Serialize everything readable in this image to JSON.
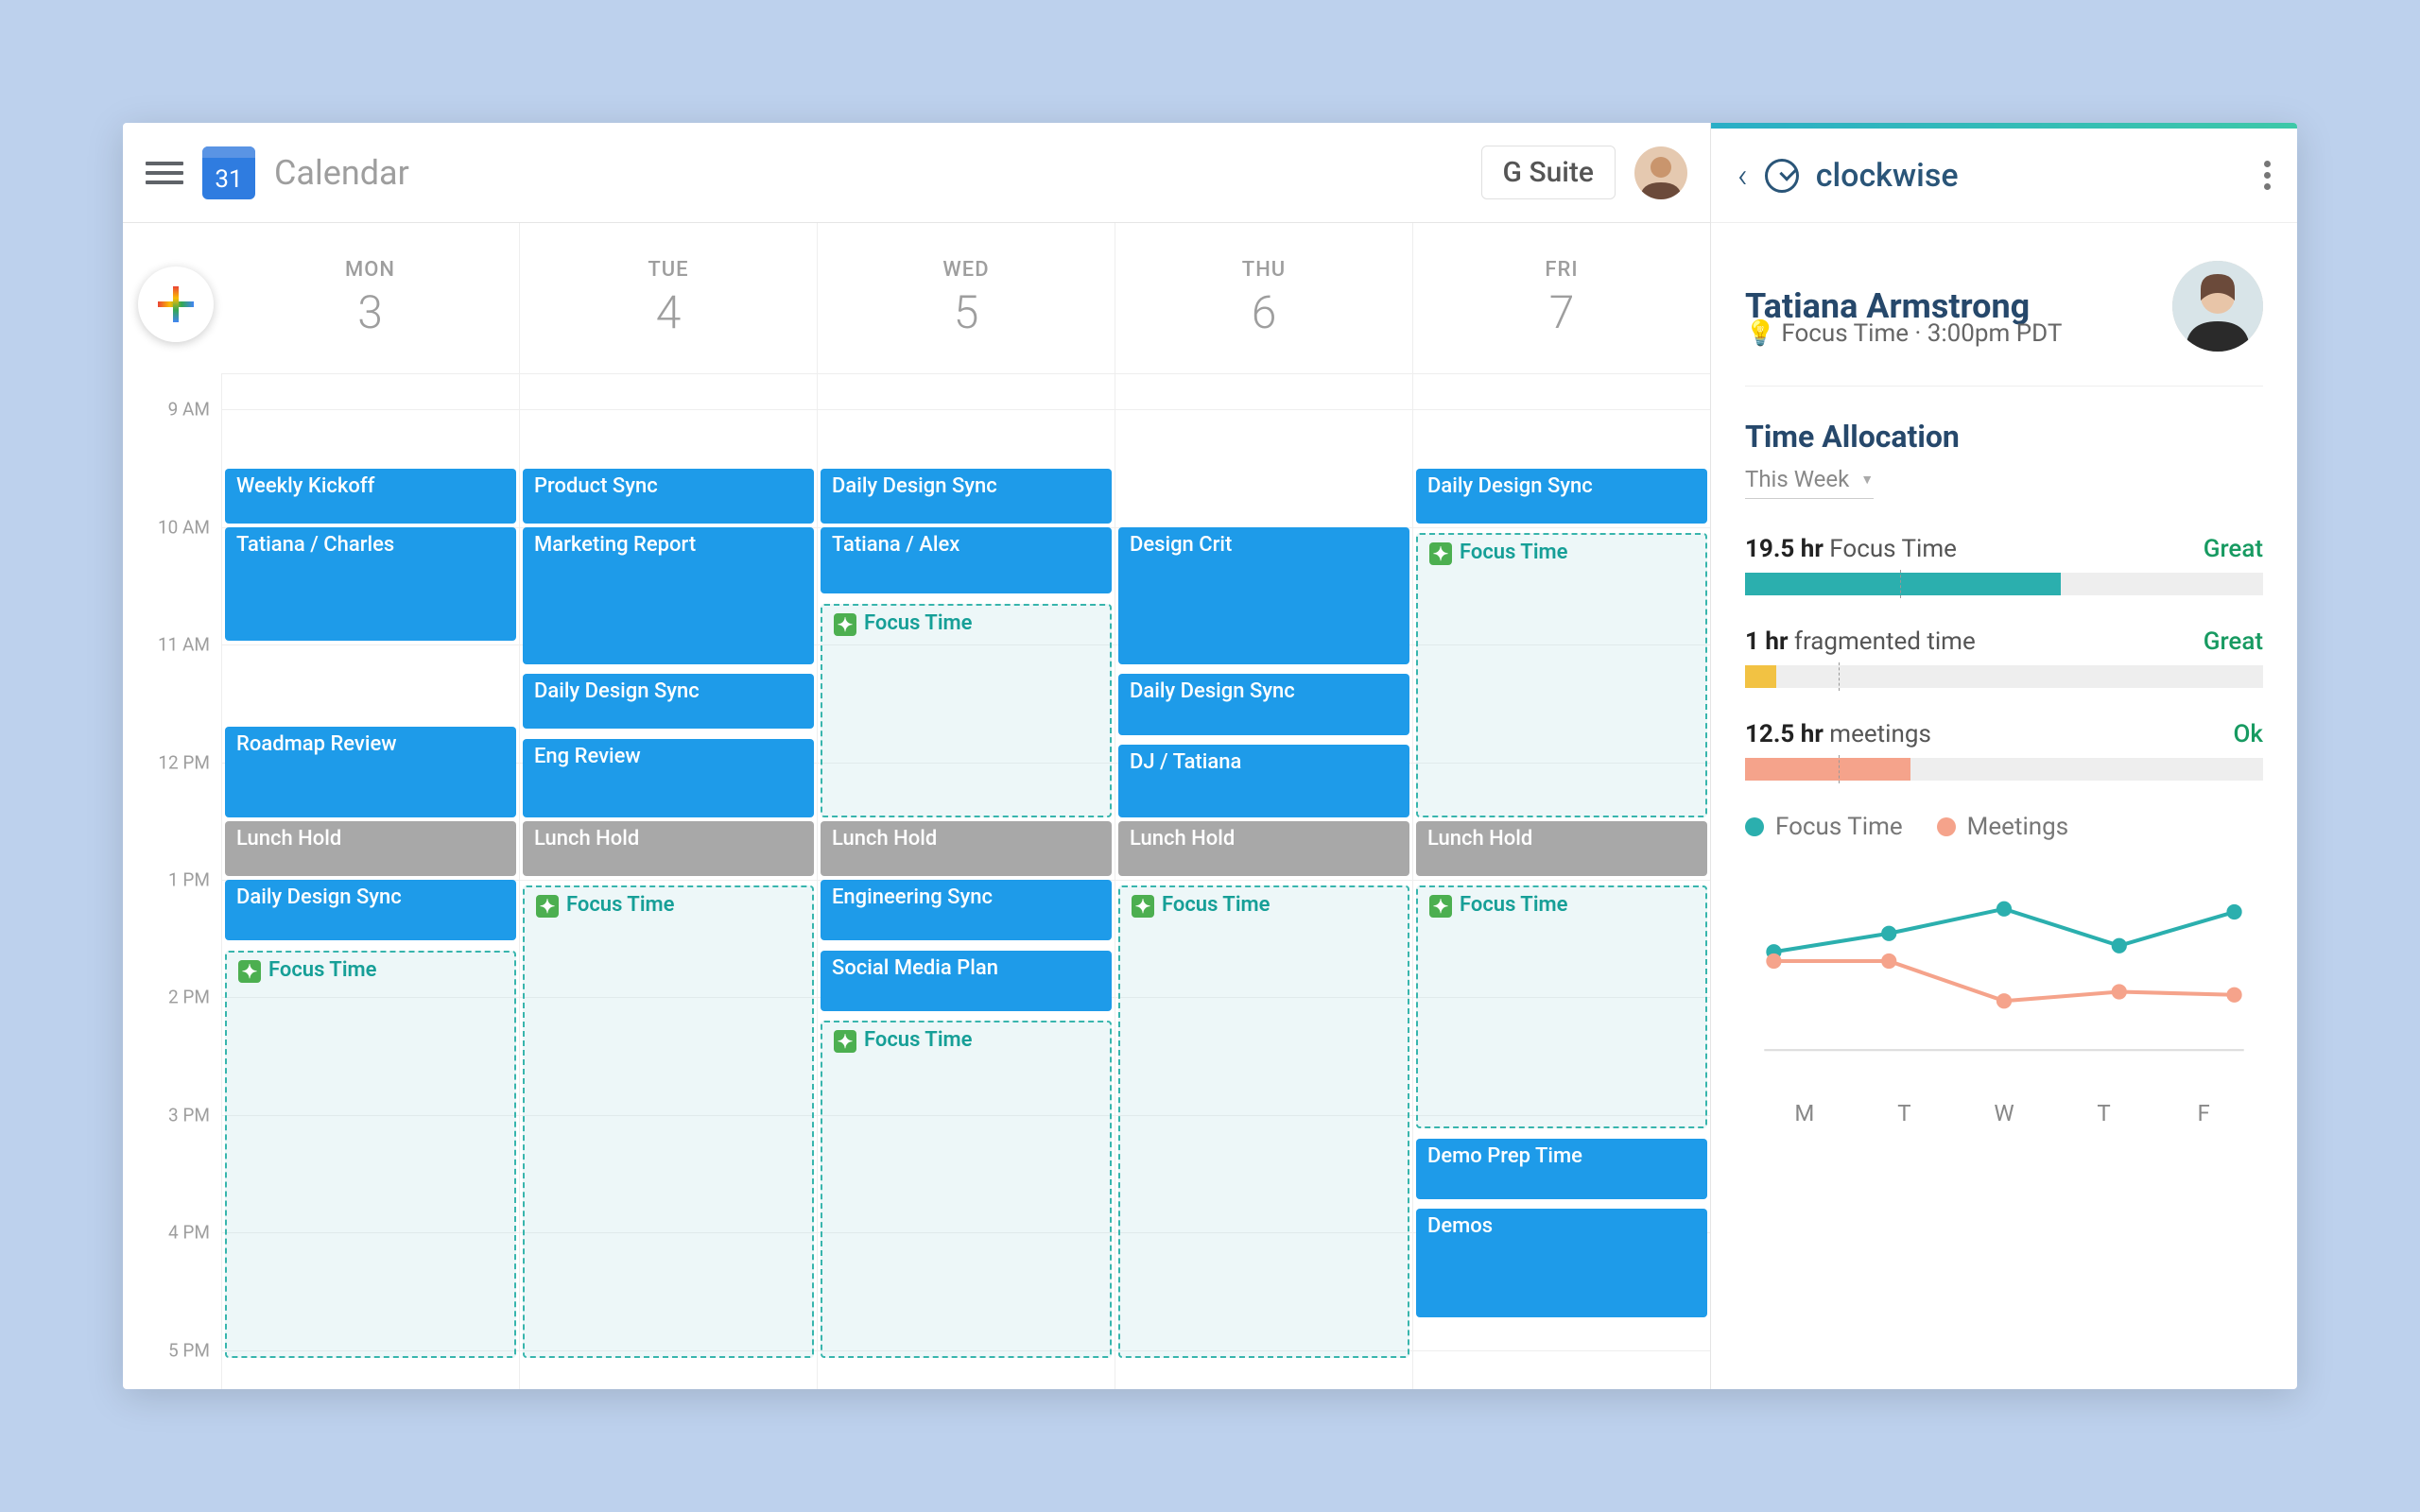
{
  "header": {
    "logo_day": "31",
    "title": "Calendar",
    "gsuite_label": "G Suite"
  },
  "calendar": {
    "days": [
      {
        "name": "MON",
        "num": "3"
      },
      {
        "name": "TUE",
        "num": "4"
      },
      {
        "name": "WED",
        "num": "5"
      },
      {
        "name": "THU",
        "num": "6"
      },
      {
        "name": "FRI",
        "num": "7"
      }
    ],
    "hours": [
      "9 AM",
      "10 AM",
      "11 AM",
      "12 PM",
      "1 PM",
      "2 PM",
      "3 PM",
      "4 PM",
      "5 PM"
    ],
    "events": {
      "mon": [
        {
          "label": "Weekly Kickoff",
          "type": "blue",
          "start": 9.5,
          "end": 10
        },
        {
          "label": "Tatiana / Charles",
          "type": "blue",
          "start": 10,
          "end": 11
        },
        {
          "label": "Roadmap Review",
          "type": "blue",
          "start": 11.7,
          "end": 12.5
        },
        {
          "label": "Lunch Hold",
          "type": "gray",
          "start": 12.5,
          "end": 13
        },
        {
          "label": "Daily Design Sync",
          "type": "blue",
          "start": 13,
          "end": 13.55
        },
        {
          "label": "Focus Time",
          "type": "focus",
          "start": 13.6,
          "end": 17.1
        }
      ],
      "tue": [
        {
          "label": "Product Sync",
          "type": "blue",
          "start": 9.5,
          "end": 10
        },
        {
          "label": "Marketing Report",
          "type": "blue",
          "start": 10,
          "end": 11.2
        },
        {
          "label": "Daily Design Sync",
          "type": "blue",
          "start": 11.25,
          "end": 11.75
        },
        {
          "label": "Eng Review",
          "type": "blue",
          "start": 11.8,
          "end": 12.5
        },
        {
          "label": "Lunch Hold",
          "type": "gray",
          "start": 12.5,
          "end": 13
        },
        {
          "label": "Focus Time",
          "type": "focus",
          "start": 13.05,
          "end": 17.1
        }
      ],
      "wed": [
        {
          "label": "Daily Design Sync",
          "type": "blue",
          "start": 9.5,
          "end": 10
        },
        {
          "label": "Tatiana / Alex",
          "type": "blue",
          "start": 10,
          "end": 10.6
        },
        {
          "label": "Focus Time",
          "type": "focus",
          "start": 10.65,
          "end": 12.5
        },
        {
          "label": "Lunch Hold",
          "type": "gray",
          "start": 12.5,
          "end": 13
        },
        {
          "label": "Engineering Sync",
          "type": "blue",
          "start": 13,
          "end": 13.55
        },
        {
          "label": "Social Media Plan",
          "type": "blue",
          "start": 13.6,
          "end": 14.15
        },
        {
          "label": "Focus Time",
          "type": "focus",
          "start": 14.2,
          "end": 17.1
        }
      ],
      "thu": [
        {
          "label": "Design Crit",
          "type": "blue",
          "start": 10,
          "end": 11.2
        },
        {
          "label": "Daily Design Sync",
          "type": "blue",
          "start": 11.25,
          "end": 11.8
        },
        {
          "label": "DJ / Tatiana",
          "type": "blue",
          "start": 11.85,
          "end": 12.5
        },
        {
          "label": "Lunch Hold",
          "type": "gray",
          "start": 12.5,
          "end": 13
        },
        {
          "label": "Focus Time",
          "type": "focus",
          "start": 13.05,
          "end": 17.1
        }
      ],
      "fri": [
        {
          "label": "Daily Design Sync",
          "type": "blue",
          "start": 9.5,
          "end": 10
        },
        {
          "label": "Focus Time",
          "type": "focus",
          "start": 10.05,
          "end": 12.5
        },
        {
          "label": "Lunch Hold",
          "type": "gray",
          "start": 12.5,
          "end": 13
        },
        {
          "label": "Focus Time",
          "type": "focus",
          "start": 13.05,
          "end": 15.15
        },
        {
          "label": "Demo Prep Time",
          "type": "blue",
          "start": 15.2,
          "end": 15.75
        },
        {
          "label": "Demos",
          "type": "blue",
          "start": 15.8,
          "end": 16.75
        }
      ]
    }
  },
  "sidebar": {
    "brand": "clockwise",
    "person_name": "Tatiana Armstrong",
    "status_icon": "💡",
    "status_text": "Focus Time · 3:00pm PDT",
    "section_title": "Time Allocation",
    "period_label": "This Week",
    "metrics": [
      {
        "value": "19.5 hr",
        "label": "Focus Time",
        "status": "Great",
        "fill": 61,
        "color": "#2bafae",
        "divider": 30
      },
      {
        "value": "1 hr",
        "label": "fragmented time",
        "status": "Great",
        "fill": 6,
        "color": "#f2c243",
        "divider": 18
      },
      {
        "value": "12.5 hr",
        "label": "meetings",
        "status": "Ok",
        "fill": 32,
        "color": "#f5a38b",
        "divider": 18
      }
    ],
    "legend": {
      "focus": "Focus Time",
      "meetings": "Meetings"
    },
    "colors": {
      "focus": "#2bafae",
      "meetings": "#f5a38b"
    },
    "x_labels": [
      "M",
      "T",
      "W",
      "T",
      "F"
    ]
  },
  "chart_data": {
    "type": "line",
    "title": "Time Allocation",
    "xlabel": "",
    "ylabel": "",
    "categories": [
      "M",
      "T",
      "W",
      "T",
      "F"
    ],
    "series": [
      {
        "name": "Focus Time",
        "color": "#2bafae",
        "values": [
          3.2,
          3.8,
          4.6,
          3.4,
          4.5
        ]
      },
      {
        "name": "Meetings",
        "color": "#f5a38b",
        "values": [
          2.9,
          2.9,
          1.6,
          1.9,
          1.8
        ]
      }
    ],
    "ylim": [
      0,
      5
    ]
  }
}
